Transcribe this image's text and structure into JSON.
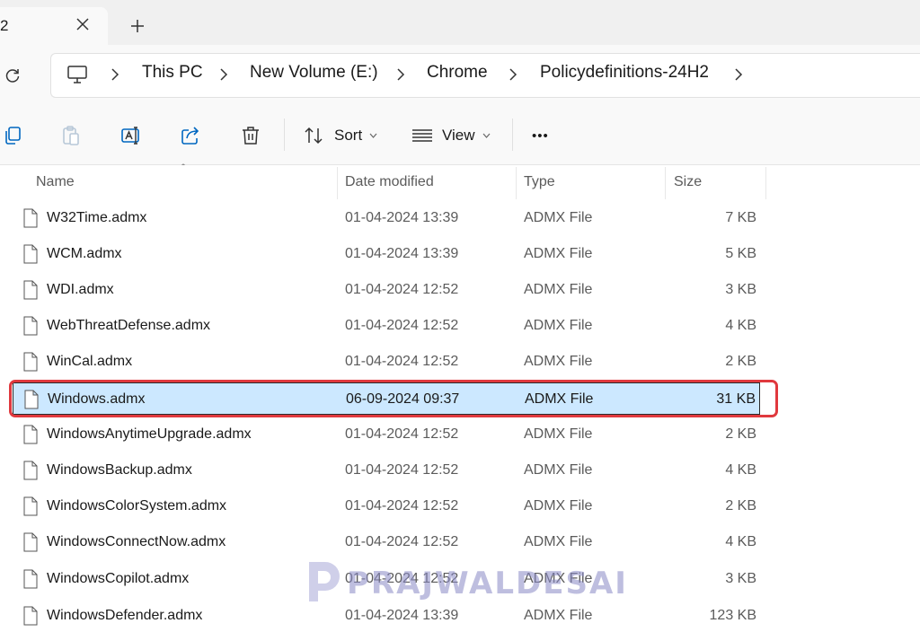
{
  "tab": {
    "title": "2"
  },
  "breadcrumb": {
    "items": [
      "This PC",
      "New Volume (E:)",
      "Chrome",
      "Policydefinitions-24H2"
    ]
  },
  "toolbar": {
    "sort_label": "Sort",
    "view_label": "View",
    "more_label": "•••"
  },
  "columns": {
    "name": "Name",
    "date": "Date modified",
    "type": "Type",
    "size": "Size"
  },
  "files": [
    {
      "name": "W32Time.admx",
      "date": "01-04-2024 13:39",
      "type": "ADMX File",
      "size": "7 KB"
    },
    {
      "name": "WCM.admx",
      "date": "01-04-2024 13:39",
      "type": "ADMX File",
      "size": "5 KB"
    },
    {
      "name": "WDI.admx",
      "date": "01-04-2024 12:52",
      "type": "ADMX File",
      "size": "3 KB"
    },
    {
      "name": "WebThreatDefense.admx",
      "date": "01-04-2024 12:52",
      "type": "ADMX File",
      "size": "4 KB"
    },
    {
      "name": "WinCal.admx",
      "date": "01-04-2024 12:52",
      "type": "ADMX File",
      "size": "2 KB"
    },
    {
      "name": "Windows.admx",
      "date": "06-09-2024 09:37",
      "type": "ADMX File",
      "size": "31 KB"
    },
    {
      "name": "WindowsAnytimeUpgrade.admx",
      "date": "01-04-2024 12:52",
      "type": "ADMX File",
      "size": "2 KB"
    },
    {
      "name": "WindowsBackup.admx",
      "date": "01-04-2024 12:52",
      "type": "ADMX File",
      "size": "4 KB"
    },
    {
      "name": "WindowsColorSystem.admx",
      "date": "01-04-2024 12:52",
      "type": "ADMX File",
      "size": "2 KB"
    },
    {
      "name": "WindowsConnectNow.admx",
      "date": "01-04-2024 12:52",
      "type": "ADMX File",
      "size": "4 KB"
    },
    {
      "name": "WindowsCopilot.admx",
      "date": "01-04-2024 12:52",
      "type": "ADMX File",
      "size": "3 KB"
    },
    {
      "name": "WindowsDefender.admx",
      "date": "01-04-2024 13:39",
      "type": "ADMX File",
      "size": "123 KB"
    }
  ],
  "selected_file": "Windows.admx",
  "watermark": {
    "text": "PRAJWALDESAI"
  },
  "colors": {
    "selection": "#cce8ff",
    "highlight": "#e0393e",
    "accent": "#0067c0"
  }
}
